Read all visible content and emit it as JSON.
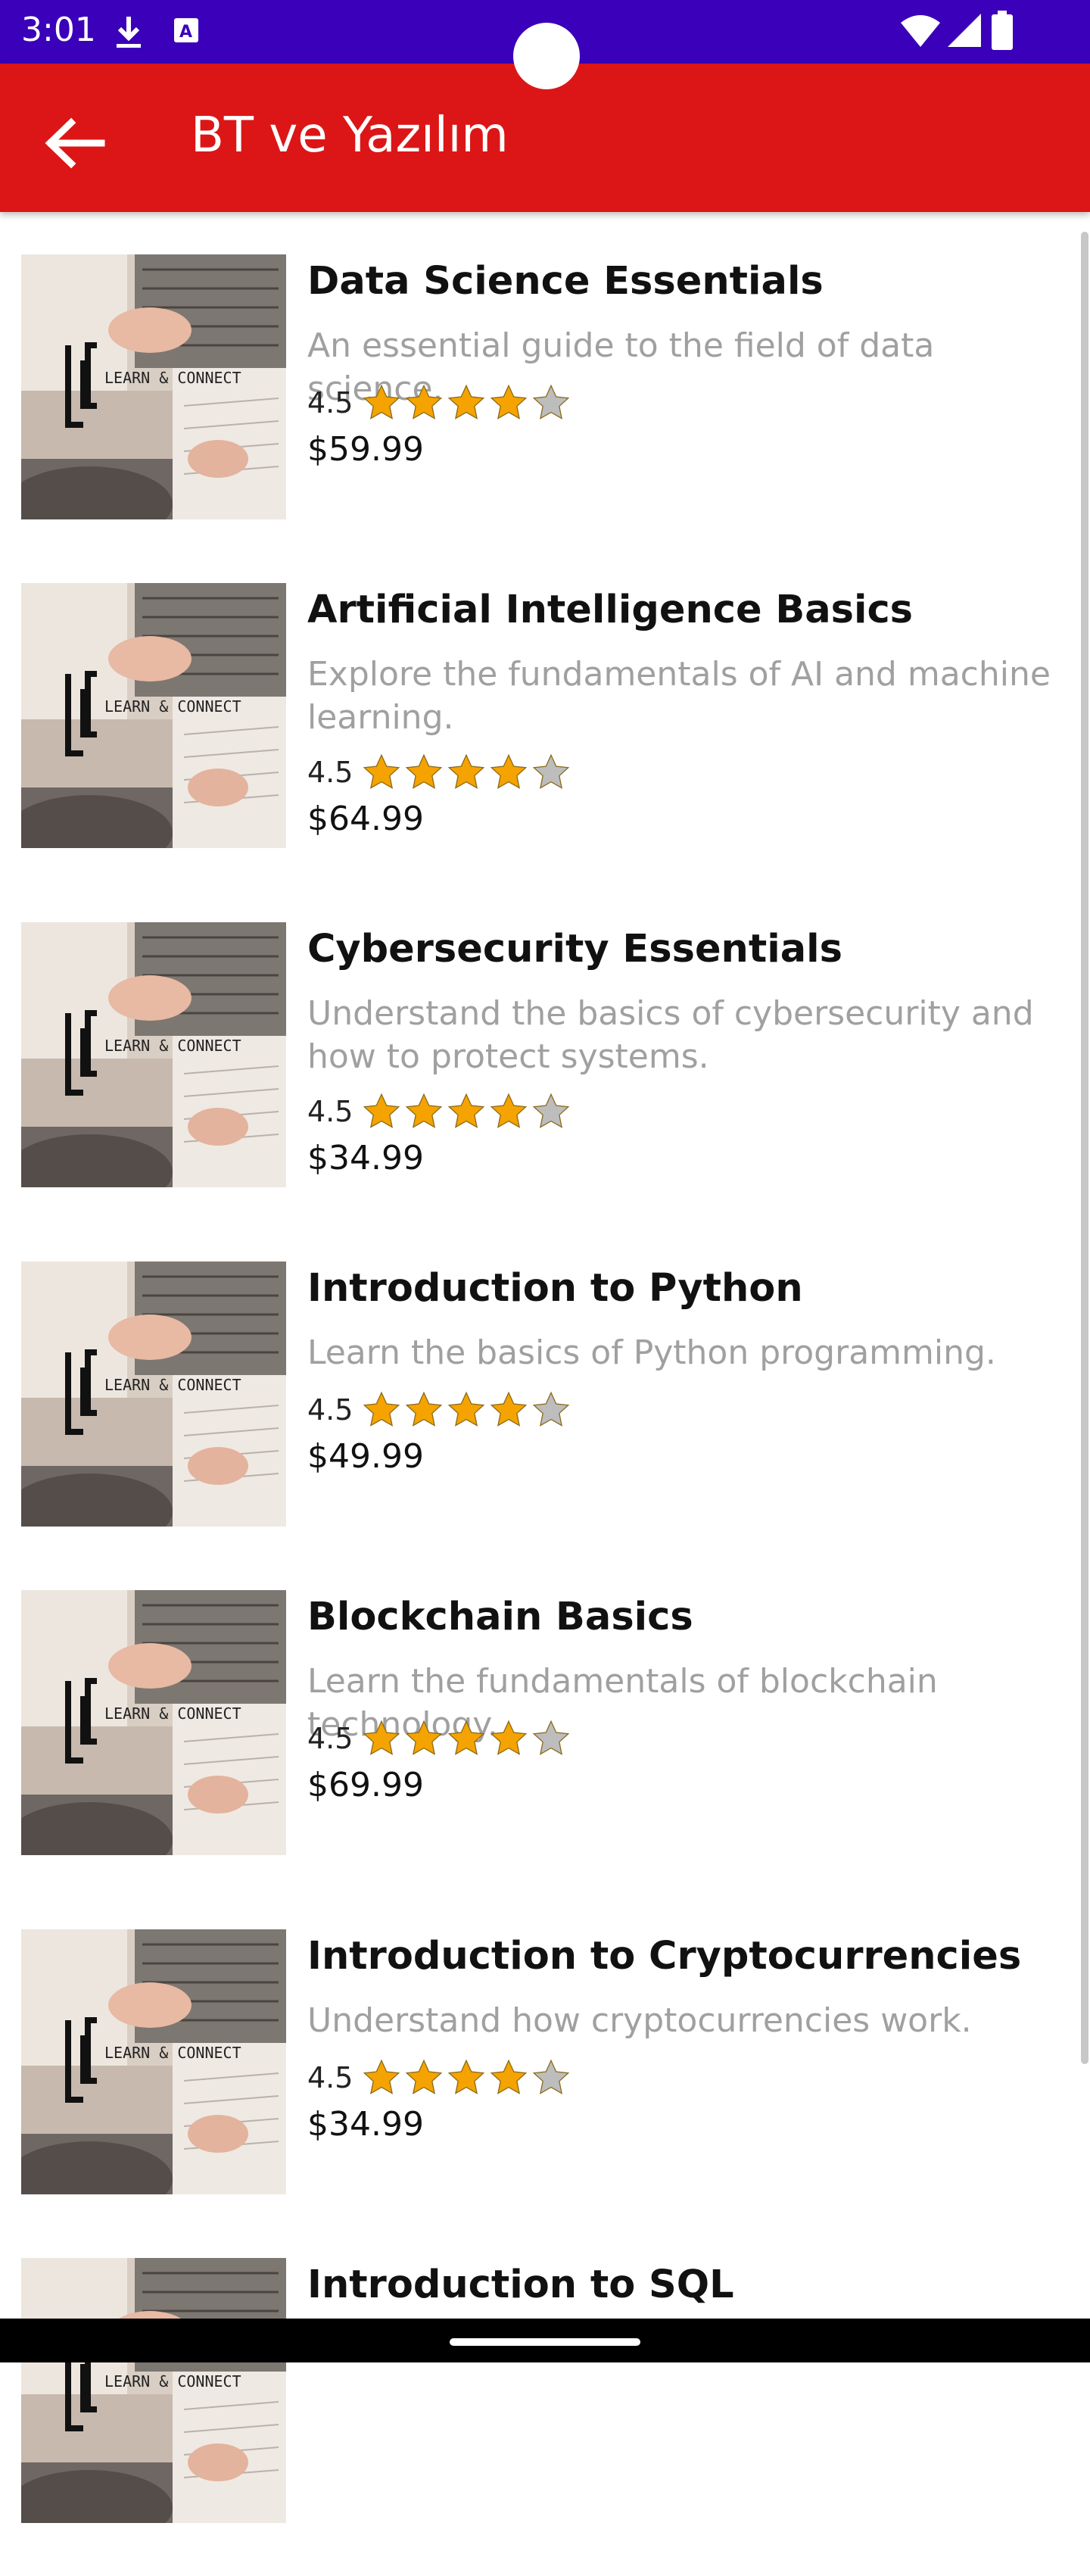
{
  "status_bar": {
    "time": "3:01",
    "icons": [
      "download-icon",
      "a11y-icon",
      "camera-notch",
      "wifi-icon",
      "signal-icon",
      "battery-icon"
    ]
  },
  "app_bar": {
    "title": "BT ve Yazılım",
    "back_icon": "arrow-back-icon",
    "color": "#dc1616"
  },
  "thumbnail": {
    "logo_text": "LEARN & CONNECT"
  },
  "colors": {
    "status_bar": "#3b00b9",
    "description": "#a0a0a0",
    "star_filled": "#f5a300",
    "star_empty": "#bdbdbd"
  },
  "courses": [
    {
      "title": "Data Science Essentials",
      "description": "An essential guide to the field of data science.",
      "rating": "4.5",
      "stars": 4,
      "price": "$59.99"
    },
    {
      "title": "Artificial Intelligence Basics",
      "description": "Explore the fundamentals of AI and machine learning.",
      "rating": "4.5",
      "stars": 4,
      "price": "$64.99"
    },
    {
      "title": "Cybersecurity Essentials",
      "description": "Understand the basics of cybersecurity and how to protect systems.",
      "rating": "4.5",
      "stars": 4,
      "price": "$34.99"
    },
    {
      "title": "Introduction to Python",
      "description": "Learn the basics of Python programming.",
      "rating": "4.5",
      "stars": 4,
      "price": "$49.99"
    },
    {
      "title": "Blockchain Basics",
      "description": "Learn the fundamentals of blockchain technology.",
      "rating": "4.5",
      "stars": 4,
      "price": "$69.99"
    },
    {
      "title": "Introduction to Cryptocurrencies",
      "description": "Understand how cryptocurrencies work.",
      "rating": "4.5",
      "stars": 4,
      "price": "$34.99"
    },
    {
      "title": "Introduction to SQL",
      "description": "",
      "rating": "",
      "stars": 0,
      "price": ""
    }
  ]
}
